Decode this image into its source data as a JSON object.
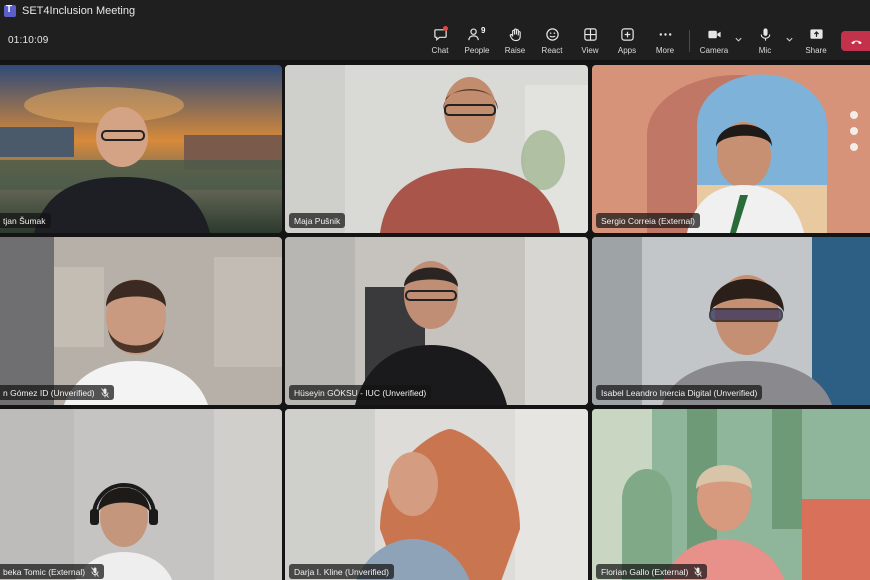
{
  "app": {
    "title": "SET4Inclusion Meeting",
    "logo_icon": "teams-logo-icon"
  },
  "toolbar": {
    "timer": "01:10:09",
    "participant_count": "9",
    "buttons": {
      "chat": "Chat",
      "people": "People",
      "raise": "Raise",
      "react": "React",
      "view": "View",
      "apps": "Apps",
      "more": "More",
      "camera": "Camera",
      "mic": "Mic",
      "share": "Share"
    },
    "leave_color": "#c4314b"
  },
  "participants": [
    {
      "name": "tjan Šumak",
      "muted": false
    },
    {
      "name": "Maja Pušnik",
      "muted": false
    },
    {
      "name": "Sergio Correia (External)",
      "muted": false
    },
    {
      "name": "n Gómez ID (Unverified)",
      "muted": true
    },
    {
      "name": "Hüseyin GÖKSU - IUC (Unverified)",
      "muted": false
    },
    {
      "name": "Isabel Leandro Inercia Digital (Unverified)",
      "muted": false,
      "active_speaker": true
    },
    {
      "name": "beka Tomic (External)",
      "muted": true
    },
    {
      "name": "Darja I. Kline (Unverified)",
      "muted": false
    },
    {
      "name": "Florian Gallo (External)",
      "muted": true
    }
  ],
  "colors": {
    "accent": "#8f92e6",
    "brand": "#5b5fc7",
    "leave": "#c4314b"
  }
}
